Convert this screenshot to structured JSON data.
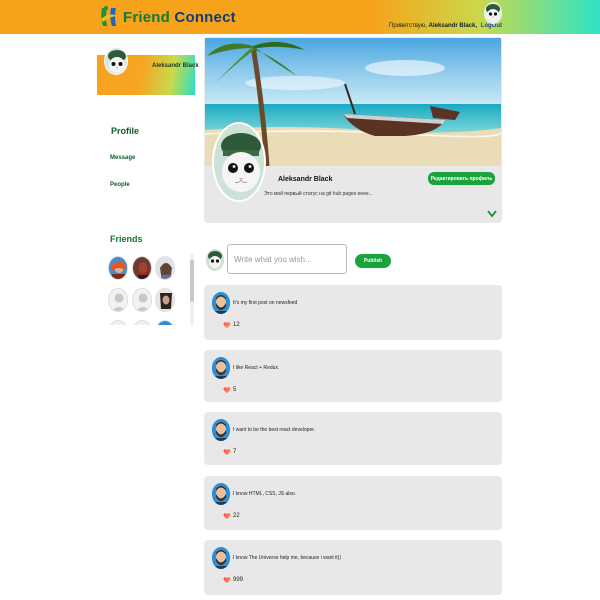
{
  "header": {
    "brand_first": "Friend",
    "brand_second": "Connect",
    "greeting_prefix": "Приветствую,",
    "user_name": "Aleksandr Black,",
    "logout_label": "LogOut"
  },
  "sidebar": {
    "profile_name": "Aleksandr Black",
    "menu": {
      "profile": "Profile",
      "message": "Message",
      "people": "People"
    },
    "friends_title": "Friends"
  },
  "profile": {
    "name": "Aleksandr Black",
    "status": "Это мой первый статус на git hub pages eeee...",
    "edit_button": "Редактировать профиль"
  },
  "composer": {
    "placeholder": "Write what you wish...",
    "publish_label": "Publish"
  },
  "posts": [
    {
      "text": "It's my first post on newsfeed",
      "likes": "12"
    },
    {
      "text": "I like React + Redux.",
      "likes": "5"
    },
    {
      "text": "I want to be the best react developer.",
      "likes": "7"
    },
    {
      "text": "I know HTML, CSS, JS also.",
      "likes": "22"
    },
    {
      "text": "I know The Universe help me, because i want it))",
      "likes": "999"
    }
  ],
  "icons": {
    "logo": "friend-connect-logo-icon",
    "expand": "chevron-down-icon",
    "like": "heart-icon"
  },
  "colors": {
    "header_orange": "#f7a21b",
    "header_teal": "#2fe3c8",
    "accent_green": "#1aa33c",
    "text_dark_green": "#0e5d2c",
    "logout_blue": "#1d3cb3",
    "card_gray": "#e8e8e8"
  }
}
